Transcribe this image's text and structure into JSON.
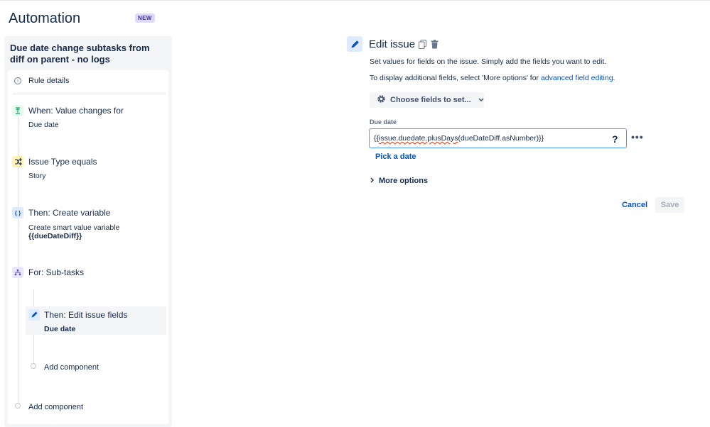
{
  "app": {
    "title": "Automation",
    "badge": "NEW"
  },
  "rule": {
    "name": "Due date change subtasks from diff on parent - no logs",
    "details_label": "Rule details",
    "components": [
      {
        "title": "When: Value changes for",
        "subtitle": "Due date",
        "icon": "trigger-icon",
        "color": "#36b37e"
      },
      {
        "title": "Issue Type equals",
        "subtitle": "Story",
        "icon": "shuffle-icon",
        "color": "#ffc400"
      },
      {
        "title": "Then: Create variable",
        "subtitle": "Create smart value variable",
        "subtitle_bold": "{{dueDateDiff}}",
        "icon": "braces-icon",
        "color": "#0065ff"
      },
      {
        "title": "For: Sub-tasks",
        "icon": "branch-icon",
        "color": "#6554c0"
      },
      {
        "title": "Then: Edit issue fields",
        "subtitle": "Due date",
        "icon": "pencil-icon",
        "color": "#0052cc"
      }
    ],
    "add_component_inner": "Add component",
    "add_component_outer": "Add component"
  },
  "editor": {
    "title": "Edit issue",
    "description1": "Set values for fields on the issue. Simply add the fields you want to edit.",
    "description2_prefix": "To display additional fields, select 'More options' for ",
    "description2_link": "advanced field editing",
    "description2_suffix": ".",
    "choose_fields_label": "Choose fields to set...",
    "field_label": "Due date",
    "field_value_prefix": "{{",
    "field_value_underlined": "issue.duedate.plusDays",
    "field_value_suffix": "(dueDateDiff.asNumber)}}",
    "help_symbol": "?",
    "pick_date_label": "Pick a date",
    "more_options_label": "More options",
    "cancel_label": "Cancel",
    "save_label": "Save"
  }
}
